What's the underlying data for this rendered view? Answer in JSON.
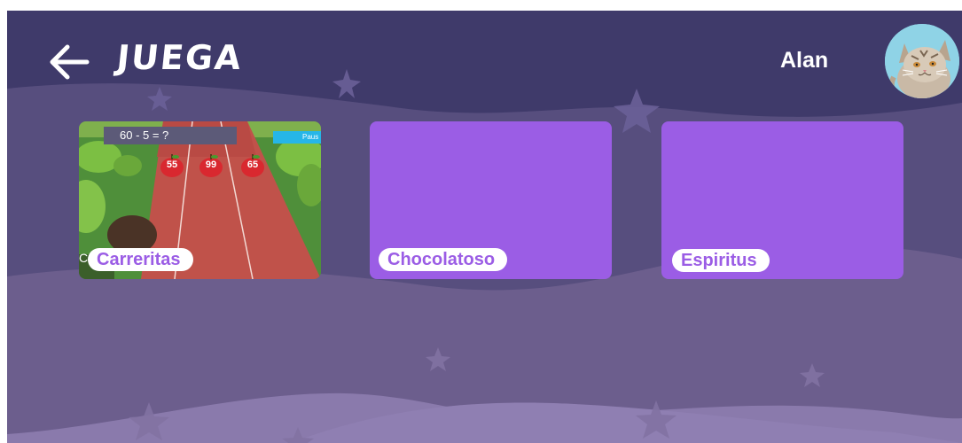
{
  "header": {
    "back_icon": "arrow-left-icon",
    "title": "JUEGA",
    "user_name": "Alan",
    "avatar_icon": "cat-avatar-icon"
  },
  "games": [
    {
      "label": "Carreritas",
      "preview": {
        "equation": "60 - 5 = ?",
        "pause_label": "Paus",
        "answers": [
          "55",
          "99",
          "65"
        ],
        "corner_text": "C"
      }
    },
    {
      "label": "Chocolatoso"
    },
    {
      "label": "Espiritus"
    }
  ],
  "colors": {
    "background_top": "#3f3a6a",
    "wave_mid": "#6d5f8e",
    "wave_light": "#8c7cae",
    "card_purple": "#9b5de5",
    "label_text": "#9b5de5",
    "pause_blue": "#26b6e8",
    "track_red": "#c0524a"
  }
}
